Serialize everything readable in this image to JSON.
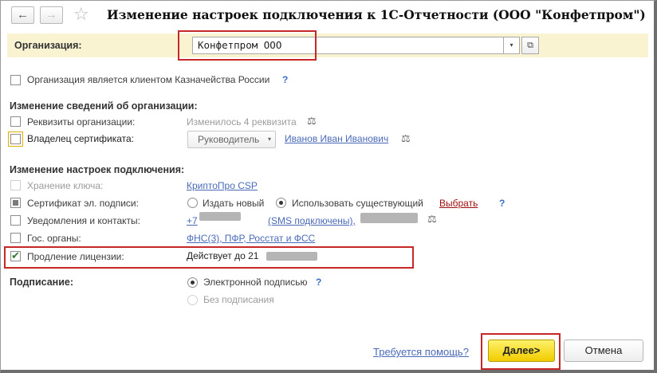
{
  "titlebar": {
    "back_icon": "←",
    "forward_icon": "→",
    "star_icon": "☆",
    "title": "Изменение настроек подключения к 1С-Отчетности (ООО \"Конфетпром\")"
  },
  "organization": {
    "label": "Организация:",
    "value": "Конфетпром ООО",
    "dropdown_icon": "▾",
    "open_icon": "⧉"
  },
  "treasury": {
    "label": "Организация является клиентом Казначейства России",
    "help": "?"
  },
  "org_changes": {
    "heading": "Изменение сведений об организации:",
    "requisites": {
      "label": "Реквизиты организации:",
      "value": "Изменилось 4 реквизита"
    },
    "owner": {
      "label": "Владелец сертификата:",
      "role": "Руководитель",
      "role_dd": "▾",
      "person": "Иванов Иван Иванович"
    },
    "scale_icon": "⚖"
  },
  "connection": {
    "heading": "Изменение настроек подключения:",
    "key_storage": {
      "label": "Хранение ключа:",
      "value": "КриптоПро CSP"
    },
    "certificate": {
      "label": "Сертификат эл. подписи:",
      "opt_new": "Издать новый",
      "opt_existing": "Использовать существующий",
      "choose": "Выбрать",
      "help": "?"
    },
    "notifications": {
      "label": "Уведомления и контакты:",
      "value": "+7",
      "value_mid": "(SMS подключены),"
    },
    "gov": {
      "label": "Гос. органы:",
      "value": "ФНС(3), ПФР, Росстат и ФСС"
    },
    "license": {
      "label": "Продление лицензии:",
      "value": "Действует до 21"
    }
  },
  "signing": {
    "heading": "Подписание:",
    "opt_electronic": "Электронной подписью",
    "opt_none": "Без подписания",
    "help": "?"
  },
  "footer": {
    "help_link": "Требуется помощь?",
    "next": "Далее>",
    "cancel": "Отмена"
  }
}
